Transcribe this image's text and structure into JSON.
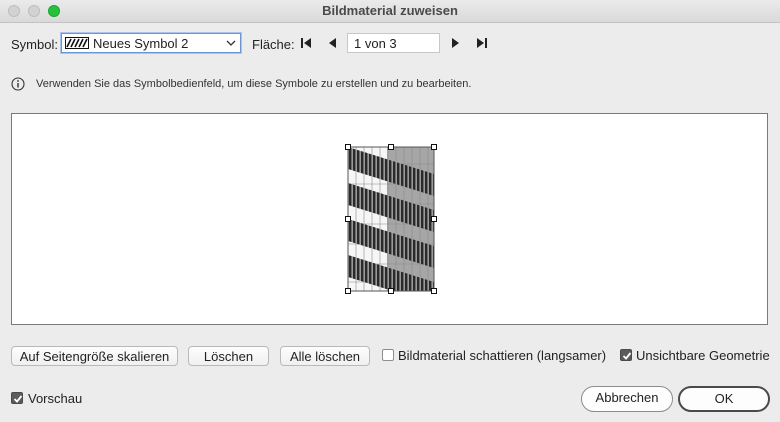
{
  "window": {
    "title": "Bildmaterial zuweisen"
  },
  "symbol": {
    "label": "Symbol:",
    "selected": "Neues Symbol 2"
  },
  "surface": {
    "label": "Fläche:",
    "page_value": "1 von 3"
  },
  "info": {
    "text": "Verwenden Sie das Symbolbedienfeld, um diese Symbole zu erstellen und zu bearbeiten."
  },
  "buttons": {
    "scale": "Auf Seitengröße skalieren",
    "delete": "Löschen",
    "delete_all": "Alle löschen",
    "cancel": "Abbrechen",
    "ok": "OK"
  },
  "options": {
    "shade_label": "Bildmaterial schattieren (langsamer)",
    "shade_checked": false,
    "invisible_label": "Unsichtbare Geometrie",
    "invisible_checked": true,
    "preview_label": "Vorschau",
    "preview_checked": true
  },
  "colors": {
    "accent_focus": "#6b95d3",
    "checkbox_on": "#5c5c5c",
    "traffic_green": "#27c23b"
  }
}
